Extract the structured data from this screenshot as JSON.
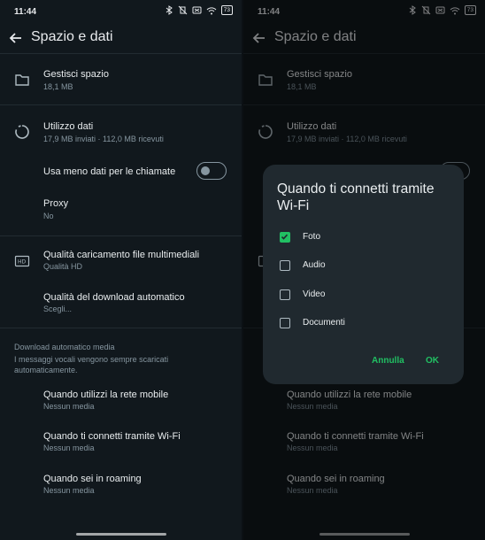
{
  "status": {
    "time": "11:44",
    "battery": "73"
  },
  "header": {
    "title": "Spazio e dati"
  },
  "storage": {
    "title": "Gestisci spazio",
    "subtitle": "18,1 MB"
  },
  "data_usage": {
    "title": "Utilizzo dati",
    "subtitle": "17,9 MB inviati · 112,0 MB ricevuti"
  },
  "low_data_calls": {
    "title": "Usa meno dati per le chiamate",
    "enabled": false
  },
  "proxy": {
    "title": "Proxy",
    "subtitle": "No"
  },
  "media_upload": {
    "title": "Qualità caricamento file multimediali",
    "subtitle": "Qualità HD"
  },
  "auto_download_quality": {
    "title": "Qualità del download automatico",
    "subtitle": "Scegli..."
  },
  "auto_download": {
    "header": "Download automatico media",
    "description": "I messaggi vocali vengono sempre scaricati automaticamente.",
    "mobile": {
      "title": "Quando utilizzi la rete mobile",
      "subtitle": "Nessun media"
    },
    "wifi": {
      "title": "Quando ti connetti tramite Wi-Fi",
      "subtitle": "Nessun media"
    },
    "roaming": {
      "title": "Quando sei in roaming",
      "subtitle": "Nessun media"
    }
  },
  "dialog": {
    "title": "Quando ti connetti tramite Wi-Fi",
    "options": [
      {
        "label": "Foto",
        "checked": true
      },
      {
        "label": "Audio",
        "checked": false
      },
      {
        "label": "Video",
        "checked": false
      },
      {
        "label": "Documenti",
        "checked": false
      }
    ],
    "cancel_label": "Annulla",
    "ok_label": "OK"
  },
  "colors": {
    "accent": "#21c063",
    "background": "#11181d",
    "dialog": "#20292f"
  }
}
